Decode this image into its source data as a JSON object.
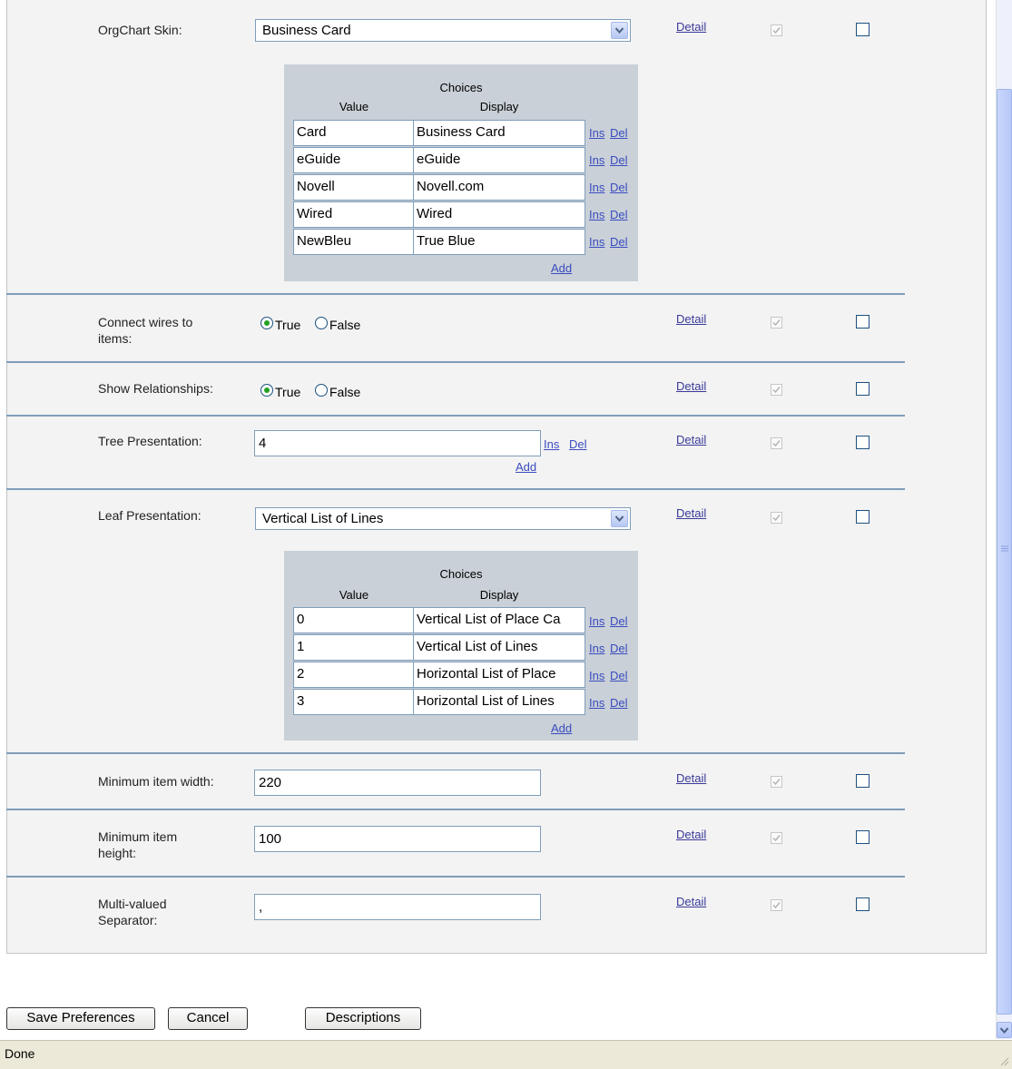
{
  "fields": {
    "orgchart_skin": {
      "label": "OrgChart Skin:",
      "selected": "Business Card",
      "choices_title": "Choices",
      "col_value": "Value",
      "col_display": "Display",
      "rows": [
        {
          "value": "Card",
          "display": "Business Card"
        },
        {
          "value": "eGuide",
          "display": "eGuide"
        },
        {
          "value": "Novell",
          "display": "Novell.com"
        },
        {
          "value": "Wired",
          "display": "Wired"
        },
        {
          "value": "NewBleu",
          "display": "True Blue"
        }
      ]
    },
    "connect_wires": {
      "label_line1": "Connect wires to",
      "label_line2": "items:",
      "true_label": "True",
      "false_label": "False",
      "selected": "True"
    },
    "show_relationships": {
      "label": "Show Relationships:",
      "true_label": "True",
      "false_label": "False",
      "selected": "True"
    },
    "tree_presentation": {
      "label": "Tree Presentation:",
      "value": "4"
    },
    "leaf_presentation": {
      "label": "Leaf Presentation:",
      "selected": "Vertical List of Lines",
      "choices_title": "Choices",
      "col_value": "Value",
      "col_display": "Display",
      "rows": [
        {
          "value": "0",
          "display": "Vertical List of Place Ca"
        },
        {
          "value": "1",
          "display": "Vertical List of Lines"
        },
        {
          "value": "2",
          "display": "Horizontal List of Place"
        },
        {
          "value": "3",
          "display": "Horizontal List of Lines"
        }
      ]
    },
    "min_item_width": {
      "label": "Minimum item width:",
      "value": "220"
    },
    "min_item_height": {
      "label_line1": "Minimum item",
      "label_line2": "height:",
      "value": "100"
    },
    "multi_valued_separator": {
      "label_line1": "Multi-valued",
      "label_line2": "Separator:",
      "value": ","
    }
  },
  "links": {
    "detail": "Detail",
    "ins": "Ins",
    "del": "Del",
    "add": "Add"
  },
  "buttons": {
    "save": "Save Preferences",
    "cancel": "Cancel",
    "descriptions": "Descriptions"
  },
  "status_bar": {
    "text": "Done"
  },
  "colors": {
    "separator": "#7f9db9",
    "panel": "#f3f3f3",
    "choices_bg": "#c9d0d7",
    "link": "#3a4cc0",
    "radio_dot": "#21a121"
  }
}
